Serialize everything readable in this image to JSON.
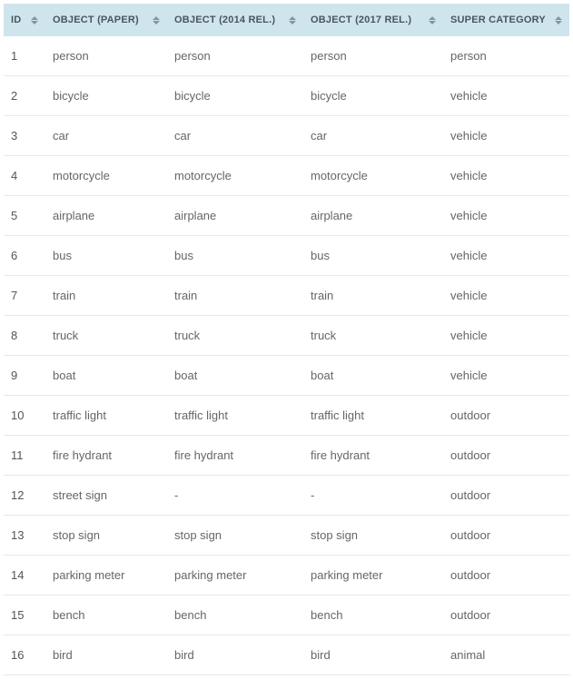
{
  "columns": {
    "id": "ID",
    "paper": "OBJECT (PAPER)",
    "r2014": "OBJECT (2014 REL.)",
    "r2017": "OBJECT (2017 REL.)",
    "super": "SUPER CATEGORY"
  },
  "rows": [
    {
      "id": "1",
      "paper": "person",
      "r2014": "person",
      "r2017": "person",
      "super": "person"
    },
    {
      "id": "2",
      "paper": "bicycle",
      "r2014": "bicycle",
      "r2017": "bicycle",
      "super": "vehicle"
    },
    {
      "id": "3",
      "paper": "car",
      "r2014": "car",
      "r2017": "car",
      "super": "vehicle"
    },
    {
      "id": "4",
      "paper": "motorcycle",
      "r2014": "motorcycle",
      "r2017": "motorcycle",
      "super": "vehicle"
    },
    {
      "id": "5",
      "paper": "airplane",
      "r2014": "airplane",
      "r2017": "airplane",
      "super": "vehicle"
    },
    {
      "id": "6",
      "paper": "bus",
      "r2014": "bus",
      "r2017": "bus",
      "super": "vehicle"
    },
    {
      "id": "7",
      "paper": "train",
      "r2014": "train",
      "r2017": "train",
      "super": "vehicle"
    },
    {
      "id": "8",
      "paper": "truck",
      "r2014": "truck",
      "r2017": "truck",
      "super": "vehicle"
    },
    {
      "id": "9",
      "paper": "boat",
      "r2014": "boat",
      "r2017": "boat",
      "super": "vehicle"
    },
    {
      "id": "10",
      "paper": "traffic light",
      "r2014": "traffic light",
      "r2017": "traffic light",
      "super": "outdoor"
    },
    {
      "id": "11",
      "paper": "fire hydrant",
      "r2014": "fire hydrant",
      "r2017": "fire hydrant",
      "super": "outdoor"
    },
    {
      "id": "12",
      "paper": "street sign",
      "r2014": "-",
      "r2017": "-",
      "super": "outdoor"
    },
    {
      "id": "13",
      "paper": "stop sign",
      "r2014": "stop sign",
      "r2017": "stop sign",
      "super": "outdoor"
    },
    {
      "id": "14",
      "paper": "parking meter",
      "r2014": "parking meter",
      "r2017": "parking meter",
      "super": "outdoor"
    },
    {
      "id": "15",
      "paper": "bench",
      "r2014": "bench",
      "r2017": "bench",
      "super": "outdoor"
    },
    {
      "id": "16",
      "paper": "bird",
      "r2014": "bird",
      "r2017": "bird",
      "super": "animal"
    }
  ]
}
